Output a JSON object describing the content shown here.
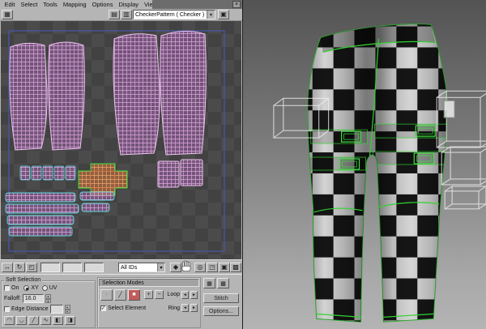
{
  "window": {
    "menus": [
      "Edit",
      "Select",
      "Tools",
      "Mapping",
      "Options",
      "Display",
      "View"
    ],
    "texture_dropdown": "CheckerPattern  ( Checker )"
  },
  "bottom_toolbar": {
    "id_filter": "All IDs"
  },
  "soft_selection": {
    "title": "Soft Selection",
    "on_label": "On",
    "xy_label": "XY",
    "uv_label": "UV",
    "falloff_label": "Falloff:",
    "falloff_value": "16.0",
    "edge_distance_label": "Edge Distance"
  },
  "selection_modes": {
    "title": "Selection Modes",
    "loop_label": "Loop",
    "ring_label": "Ring",
    "select_element_label": "Select Element",
    "stitch_label": "Stitch",
    "options_label": "Options..."
  },
  "icons": {
    "close": "×",
    "dropdown": "▾",
    "spinner_up": "▴",
    "spinner_down": "▾",
    "arrow_left": "◄",
    "arrow_right": "►",
    "check": "✓",
    "move": "↔",
    "rotate": "↻",
    "scale": "◰",
    "grid": "▦",
    "grid2": "▩",
    "map": "▤",
    "map2": "▥",
    "channel": "▣",
    "zoom": "◎",
    "zoom_region": "◳",
    "zoom_extents": "▣",
    "snap": "◆",
    "vertex": "∙",
    "edge": "╱",
    "face": "■",
    "plus": "+",
    "minus": "−",
    "curve_smooth": "◠",
    "curve_dip": "◡",
    "curve_linear": "╱",
    "curve_wave": "∿",
    "curve_half1": "◧",
    "curve_half2": "◨"
  },
  "colors": {
    "uv_wire": "#dca3e0",
    "uv_selected_edge": "#5fd7dc",
    "seam_green": "#2fd32f",
    "canvas_checker_dark": "#424242",
    "canvas_checker_light": "#4b4b4b"
  }
}
